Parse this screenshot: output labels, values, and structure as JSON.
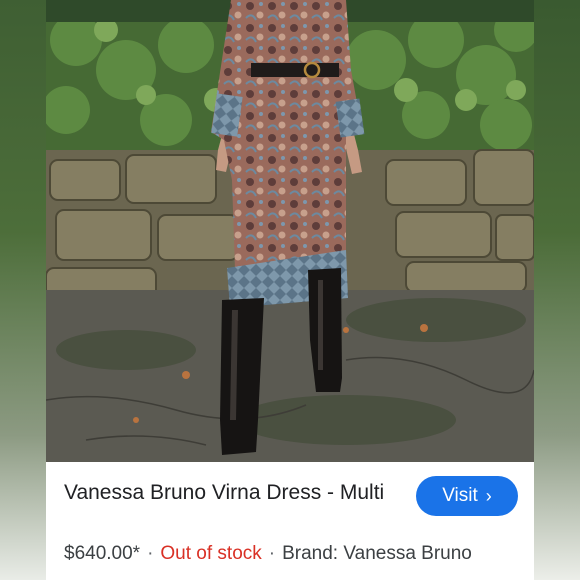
{
  "product": {
    "title": "Vanessa Bruno Virna Dress - Multi",
    "price": "$640.00*",
    "stock_status": "Out of stock",
    "brand": "Brand: Vanessa Bruno",
    "separator": "·"
  },
  "actions": {
    "visit_label": "Visit",
    "visit_chevron": "›"
  },
  "colors": {
    "visit_button": "#1a73e8",
    "out_of_stock": "#d93025",
    "text_primary": "#202124"
  },
  "image": {
    "alt": "Model wearing paisley print midi dress with black belt and black knee-high boots on a stone path"
  }
}
